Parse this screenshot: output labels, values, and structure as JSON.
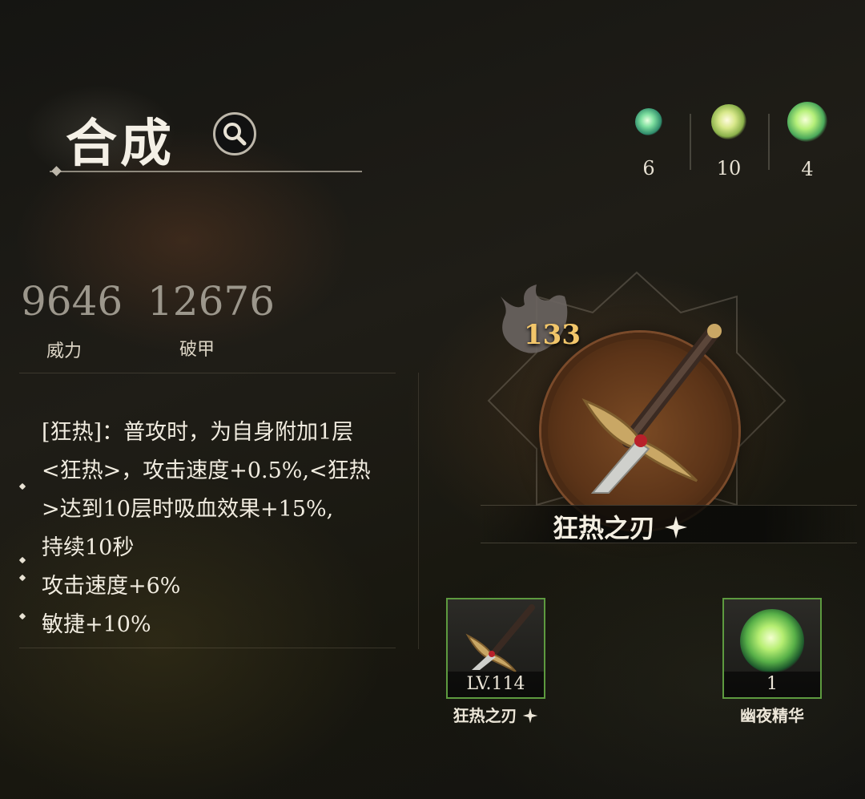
{
  "header": {
    "title": "合成"
  },
  "currencies": [
    {
      "icon": "small-essence-orb-icon",
      "count": "6"
    },
    {
      "icon": "medium-essence-orb-icon",
      "count": "10"
    },
    {
      "icon": "large-essence-orb-icon",
      "count": "4"
    }
  ],
  "stats": [
    {
      "value": "9646",
      "label": "威力"
    },
    {
      "value": "12676",
      "label": "破甲"
    }
  ],
  "effect": {
    "lines": [
      "[狂热]：普攻时，为自身附加1层",
      "<狂热>，攻击速度+0.5%,<狂热",
      ">达到10层时吸血效果+15%,",
      "持续10秒"
    ],
    "bonuses": [
      "攻击速度+6%",
      "敏捷+10%"
    ]
  },
  "weapon": {
    "level": "133",
    "name": "狂热之刃"
  },
  "materials": [
    {
      "icon": "sword-icon",
      "footer": "LV.114",
      "name": "狂热之刃"
    },
    {
      "icon": "dark-night-essence-icon",
      "footer": "1",
      "name": "幽夜精华"
    }
  ],
  "colors": {
    "accent": "#f2c66a",
    "card_border": "#5d9a3f",
    "emblem": "#6b3d1c"
  }
}
